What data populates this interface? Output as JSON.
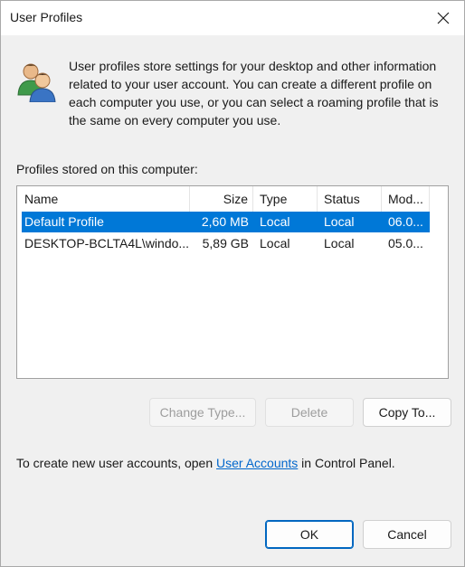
{
  "window": {
    "title": "User Profiles"
  },
  "intro": {
    "text": "User profiles store settings for your desktop and other information related to your user account. You can create a different profile on each computer you use, or you can select a roaming profile that is the same on every computer you use."
  },
  "profiles": {
    "label": "Profiles stored on this computer:",
    "columns": [
      "Name",
      "Size",
      "Type",
      "Status",
      "Mod..."
    ],
    "rows": [
      {
        "name": "Default Profile",
        "size": "2,60 MB",
        "type": "Local",
        "status": "Local",
        "modified": "06.0...",
        "selected": true
      },
      {
        "name": "DESKTOP-BCLTA4L\\windo...",
        "size": "5,89 GB",
        "type": "Local",
        "status": "Local",
        "modified": "05.0...",
        "selected": false
      }
    ]
  },
  "buttons": {
    "change_type": "Change Type...",
    "delete": "Delete",
    "copy_to": "Copy To...",
    "ok": "OK",
    "cancel": "Cancel"
  },
  "footer": {
    "prefix": "To create new user accounts, open ",
    "link": "User Accounts",
    "suffix": " in Control Panel."
  },
  "colors": {
    "selection": "#0078d7",
    "link": "#0066cc",
    "default_button_border": "#0067c0"
  },
  "icons": {
    "app": "users-icon",
    "close": "close-icon"
  }
}
